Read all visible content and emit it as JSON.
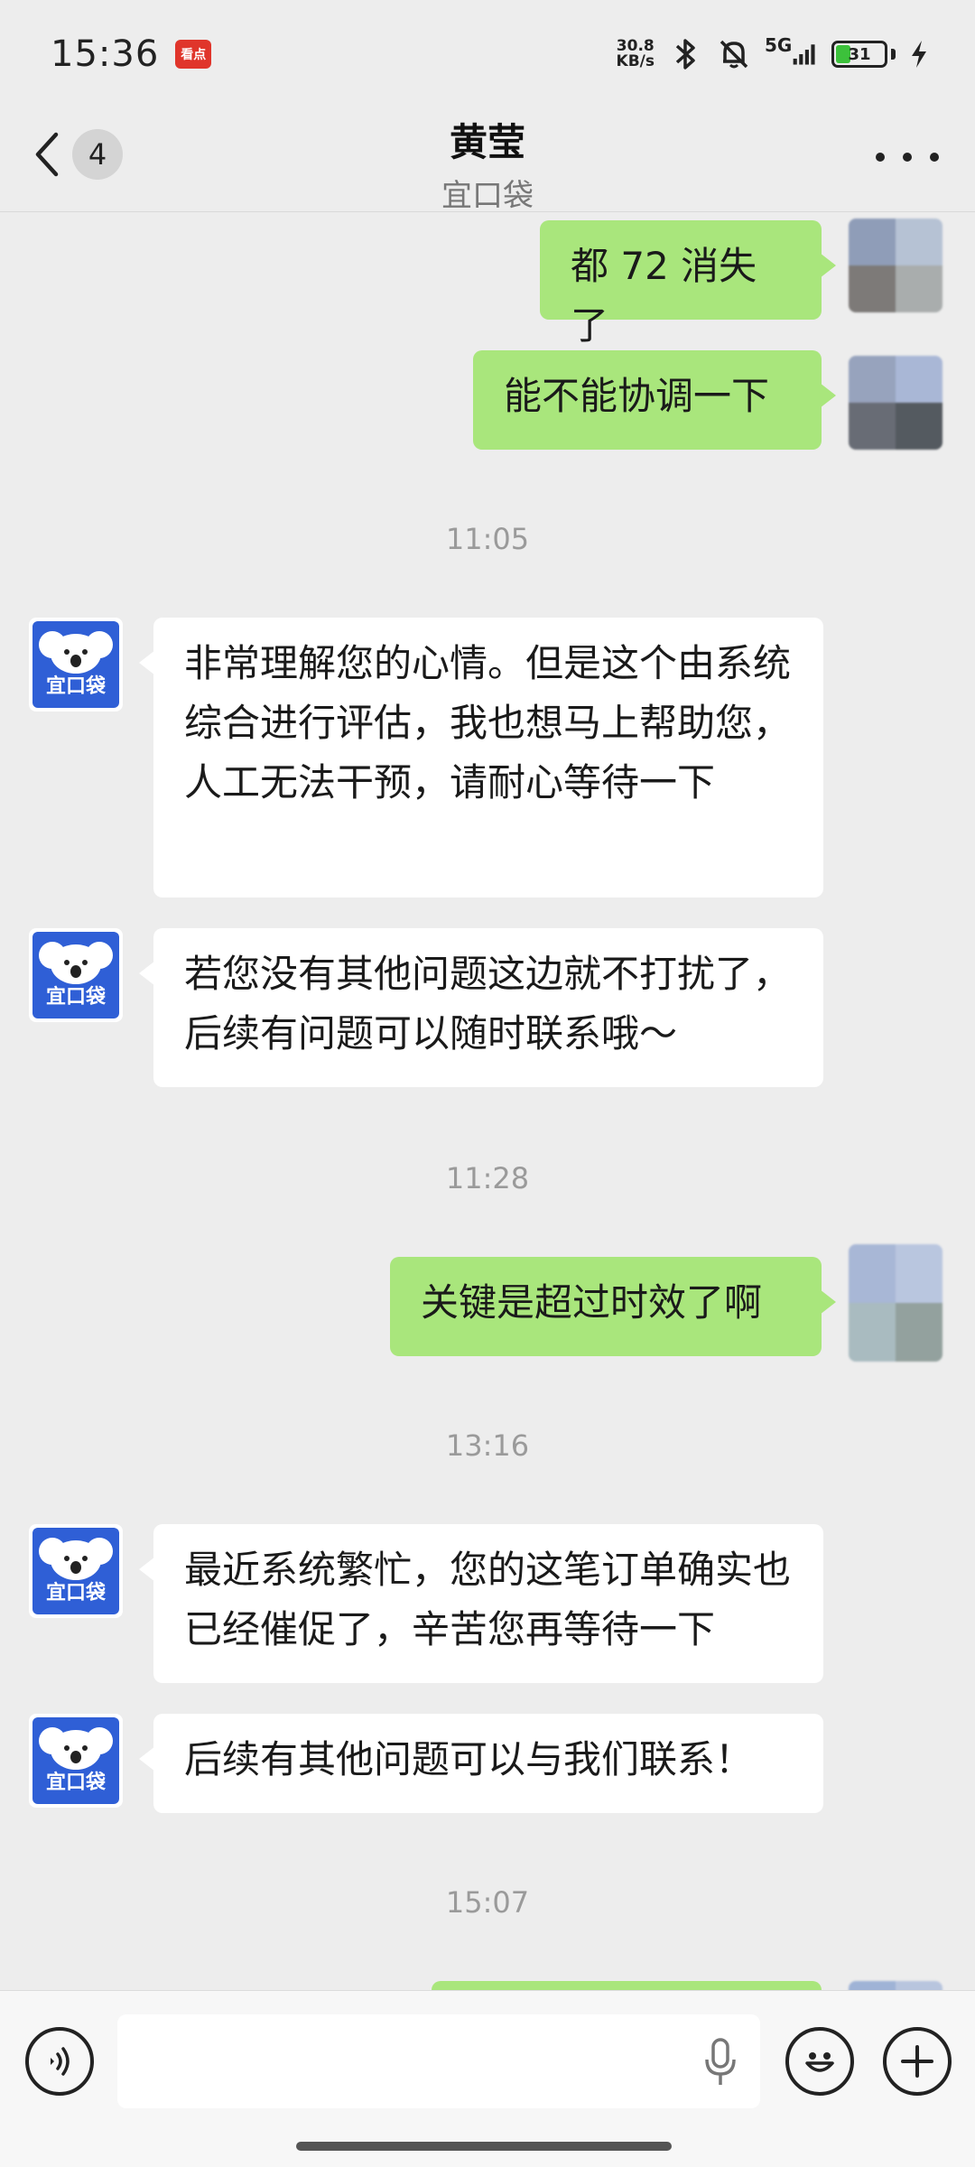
{
  "status_bar": {
    "time": "15:36",
    "app_badge": "看点",
    "net_speed_value": "30.8",
    "net_speed_unit": "KB/s",
    "network_type": "5G",
    "battery_level": "31"
  },
  "header": {
    "unread_count": "4",
    "title": "黄莹",
    "subtitle": "宜口袋"
  },
  "messages": [
    {
      "sender": "me",
      "text": "都 72 消失了"
    },
    {
      "sender": "me",
      "text": "能不能协调一下"
    },
    {
      "timestamp": "11:05"
    },
    {
      "sender": "them",
      "text": "非常理解您的心情。但是这个由系统综合进行评估，我也想马上帮助您，人工无法干预，请耐心等待一下"
    },
    {
      "sender": "them",
      "text": "若您没有其他问题这边就不打扰了，后续有问题可以随时联系哦～"
    },
    {
      "timestamp": "11:28"
    },
    {
      "sender": "me",
      "text": "关键是超过时效了啊"
    },
    {
      "timestamp": "13:16"
    },
    {
      "sender": "them",
      "text": "最近系统繁忙，您的这笔订单确实也已经催促了，辛苦您再等待一下"
    },
    {
      "sender": "them",
      "text": "后续有其他问题可以与我们联系！"
    },
    {
      "timestamp": "15:07"
    }
  ],
  "bot_avatar_label": "宜口袋",
  "colors": {
    "my_bubble": "#a9e67c",
    "their_bubble": "#ffffff",
    "background": "#ededed",
    "bot_avatar": "#2f5fd6"
  },
  "input_bar": {
    "voice_icon": "voice-icon",
    "mic_icon": "mic-icon",
    "emoji_icon": "emoji-icon",
    "plus_icon": "plus-icon"
  }
}
